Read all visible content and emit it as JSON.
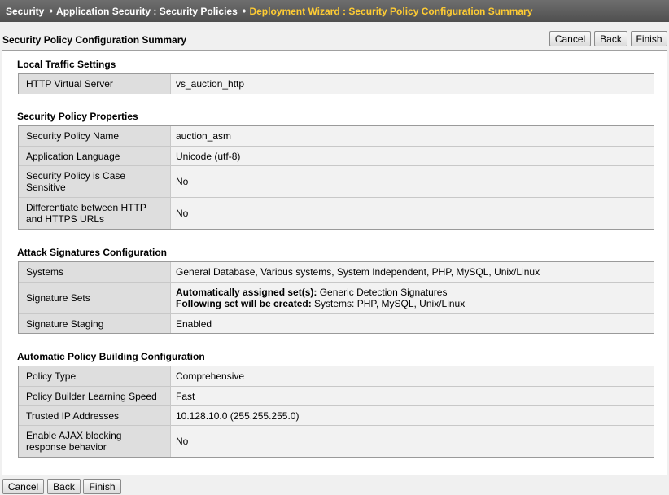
{
  "breadcrumb": {
    "items": [
      "Security",
      "Application Security : Security Policies",
      "Deployment Wizard : Security Policy Configuration Summary"
    ],
    "separator": "»"
  },
  "page_title": "Security Policy Configuration Summary",
  "buttons": {
    "cancel": "Cancel",
    "back": "Back",
    "finish": "Finish"
  },
  "sections": {
    "local_traffic": {
      "title": "Local Traffic Settings",
      "rows": [
        {
          "label": "HTTP Virtual Server",
          "value": "vs_auction_http"
        }
      ]
    },
    "policy_properties": {
      "title": "Security Policy Properties",
      "rows": [
        {
          "label": "Security Policy Name",
          "value": "auction_asm"
        },
        {
          "label": "Application Language",
          "value": "Unicode (utf-8)"
        },
        {
          "label": "Security Policy is Case Sensitive",
          "value": "No"
        },
        {
          "label": "Differentiate between HTTP and HTTPS URLs",
          "value": "No"
        }
      ]
    },
    "attack_signatures": {
      "title": "Attack Signatures Configuration",
      "systems_label": "Systems",
      "systems_value": "General Database, Various systems, System Independent, PHP, MySQL, Unix/Linux",
      "sets_label": "Signature Sets",
      "sets_line1_key": "Automatically assigned set(s):",
      "sets_line1_value": " Generic Detection Signatures",
      "sets_line2_key": "Following set will be created:",
      "sets_line2_value": " Systems: PHP, MySQL, Unix/Linux",
      "staging_label": "Signature Staging",
      "staging_value": "Enabled"
    },
    "policy_building": {
      "title": "Automatic Policy Building Configuration",
      "rows": [
        {
          "label": "Policy Type",
          "value": "Comprehensive"
        },
        {
          "label": "Policy Builder Learning Speed",
          "value": "Fast"
        },
        {
          "label": "Trusted IP Addresses",
          "value": "10.128.10.0 (255.255.255.0)"
        },
        {
          "label": "Enable AJAX blocking response behavior",
          "value": "No"
        }
      ]
    }
  }
}
